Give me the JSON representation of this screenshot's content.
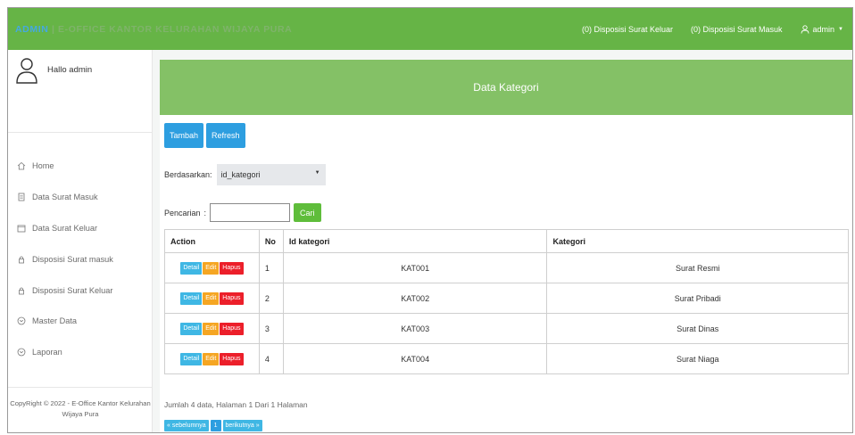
{
  "navbar": {
    "brand_highlight": "ADMIN",
    "brand_rest": " | E-OFFICE KANTOR KELURAHAN WIJAYA PURA",
    "links": [
      "(0) Disposisi Surat Keluar",
      "(0) Disposisi Surat Masuk"
    ],
    "user": "admin"
  },
  "sidebar": {
    "greeting": "Hallo admin",
    "items": [
      {
        "label": "Home",
        "icon": "home-icon"
      },
      {
        "label": "Data Surat Masuk",
        "icon": "document-icon"
      },
      {
        "label": "Data Surat Keluar",
        "icon": "folder-icon"
      },
      {
        "label": "Disposisi Surat masuk",
        "icon": "lock-icon"
      },
      {
        "label": "Disposisi Surat Keluar",
        "icon": "lock-icon"
      },
      {
        "label": "Master Data",
        "icon": "chevron-circle-icon"
      },
      {
        "label": "Laporan",
        "icon": "chevron-circle-icon"
      }
    ],
    "footer": {
      "line1": "CopyRight © 2022 - E-Office Kantor Kelurahan",
      "line2": "Wijaya Pura"
    }
  },
  "main": {
    "title": "Data Kategori",
    "buttons": {
      "tambah": "Tambah",
      "refresh": "Refresh"
    },
    "filter": {
      "label": "Berdasarkan:",
      "selected": "id_kategori"
    },
    "search": {
      "label": "Pencarian",
      "value": "",
      "button": "Cari"
    },
    "table": {
      "headers": [
        "Action",
        "No",
        "Id kategori",
        "Kategori"
      ],
      "action_labels": {
        "detail": "Detail",
        "edit": "Edit",
        "hapus": "Hapus"
      },
      "rows": [
        {
          "no": "1",
          "id": "KAT001",
          "kategori": "Surat Resmi"
        },
        {
          "no": "2",
          "id": "KAT002",
          "kategori": "Surat Pribadi"
        },
        {
          "no": "3",
          "id": "KAT003",
          "kategori": "Surat Dinas"
        },
        {
          "no": "4",
          "id": "KAT004",
          "kategori": "Surat Niaga"
        }
      ]
    },
    "summary": "Jumlah 4 data, Halaman 1 Dari 1 Halaman",
    "pagination": {
      "prev": "« sebelumnya",
      "page": "1",
      "next": "berikutnya »"
    }
  },
  "colors": {
    "navbar": "#66b446",
    "panel_header": "#84c166",
    "primary": "#2d9ee0",
    "detail": "#3fb7e4",
    "edit": "#f5a623",
    "hapus": "#ec1f2a",
    "cari": "#5fbd3b"
  }
}
